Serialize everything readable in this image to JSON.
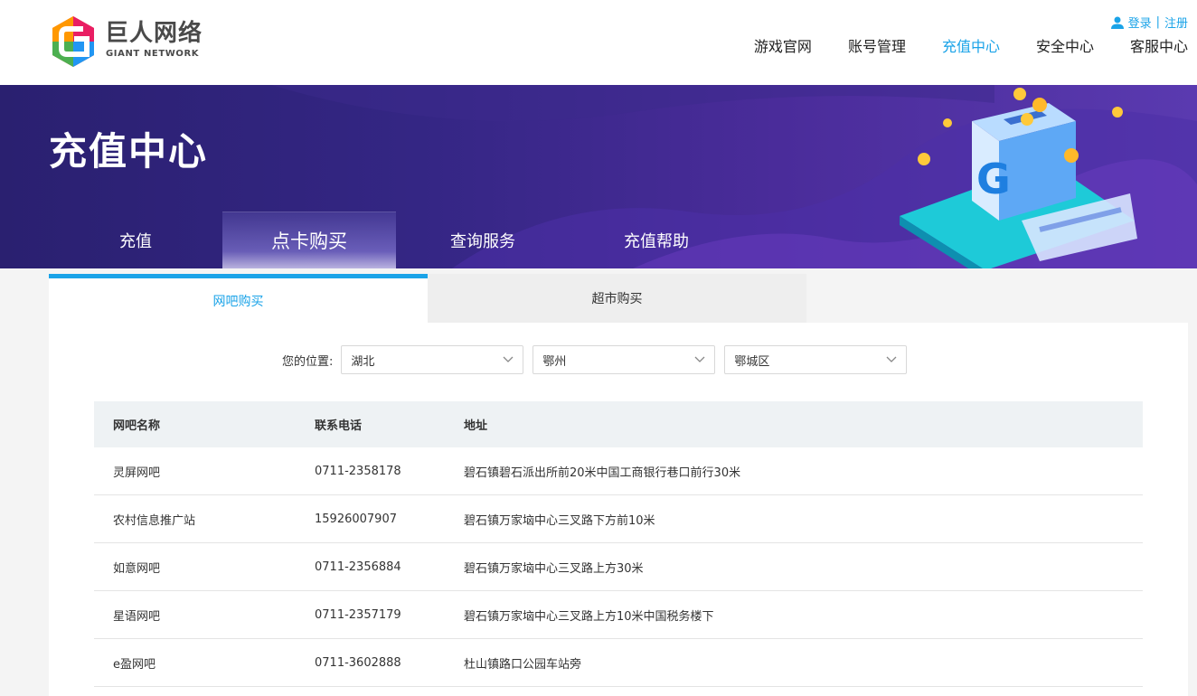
{
  "header": {
    "logo_cn": "巨人网络",
    "logo_en": "GIANT NETWORK",
    "login": "登录",
    "separator": "|",
    "register": "注册",
    "nav": [
      {
        "label": "游戏官网",
        "active": false
      },
      {
        "label": "账号管理",
        "active": false
      },
      {
        "label": "充值中心",
        "active": true
      },
      {
        "label": "安全中心",
        "active": false
      },
      {
        "label": "客服中心",
        "active": false
      }
    ]
  },
  "banner": {
    "title": "充值中心",
    "tabs": [
      {
        "label": "充值",
        "active": false
      },
      {
        "label": "点卡购买",
        "active": true
      },
      {
        "label": "查询服务",
        "active": false
      },
      {
        "label": "充值帮助",
        "active": false
      }
    ]
  },
  "subtabs": [
    {
      "label": "网吧购买",
      "active": true
    },
    {
      "label": "超市购买",
      "active": false
    }
  ],
  "location": {
    "label": "您的位置:",
    "province": "湖北",
    "city": "鄂州",
    "district": "鄂城区"
  },
  "table": {
    "headers": [
      "网吧名称",
      "联系电话",
      "地址"
    ],
    "rows": [
      {
        "name": "灵屏网吧",
        "phone": "0711-2358178",
        "address": "碧石镇碧石派出所前20米中国工商银行巷口前行30米"
      },
      {
        "name": "农村信息推广站",
        "phone": "15926007907",
        "address": "碧石镇万家垴中心三叉路下方前10米"
      },
      {
        "name": "如意网吧",
        "phone": "0711-2356884",
        "address": "碧石镇万家垴中心三叉路上方30米"
      },
      {
        "name": "星语网吧",
        "phone": "0711-2357179",
        "address": "碧石镇万家垴中心三叉路上方10米中国税务楼下"
      },
      {
        "name": "e盈网吧",
        "phone": "0711-3602888",
        "address": "杜山镇路口公园车站旁"
      }
    ]
  },
  "colors": {
    "accent": "#1aa3e8",
    "banner": "#342684"
  }
}
